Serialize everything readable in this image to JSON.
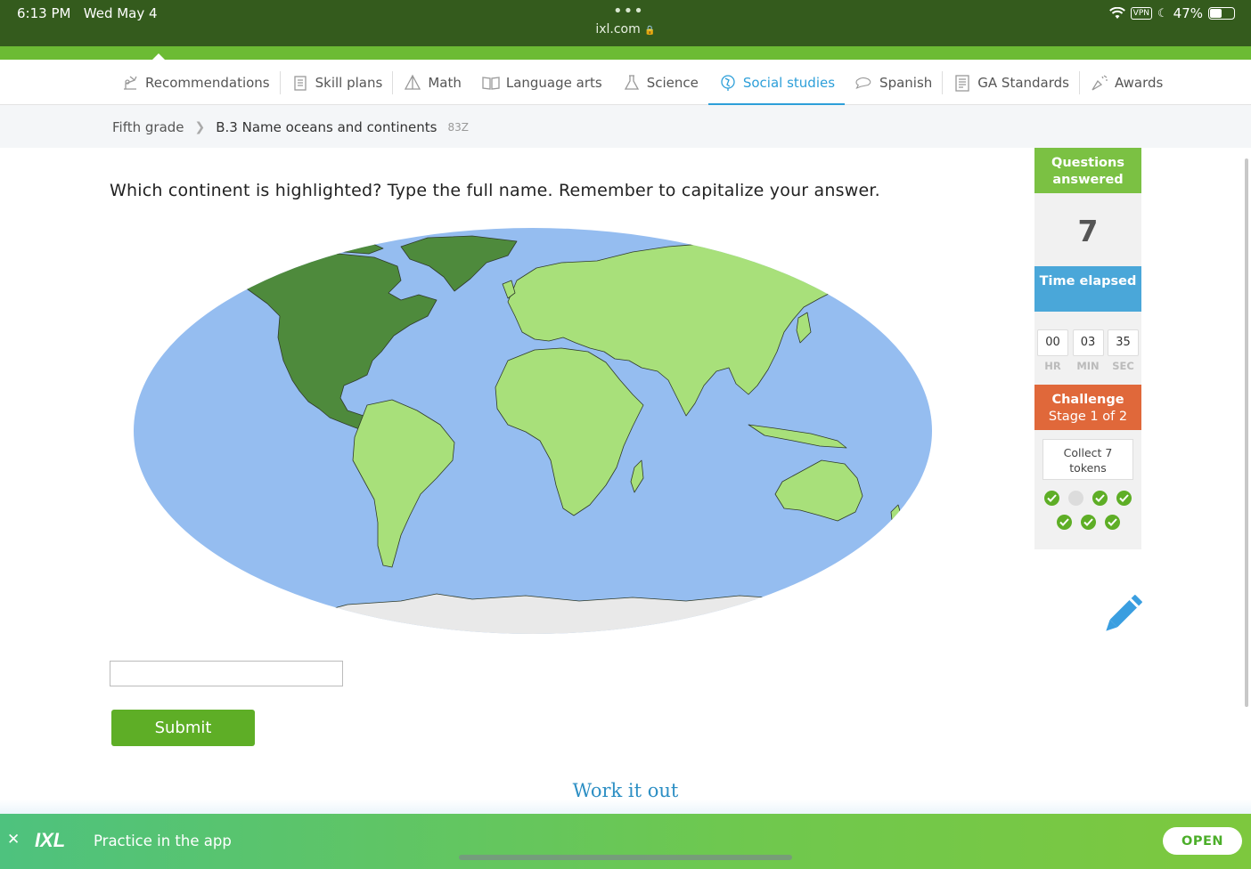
{
  "status_bar": {
    "time": "6:13 PM",
    "date": "Wed May 4",
    "url": "ixl.com",
    "battery": "47%",
    "vpn": "VPN"
  },
  "nav": {
    "items": [
      {
        "label": "Recommendations",
        "icon": "recommendations-icon"
      },
      {
        "label": "Skill plans",
        "icon": "skill-plans-icon"
      },
      {
        "label": "Math",
        "icon": "math-icon"
      },
      {
        "label": "Language arts",
        "icon": "language-arts-icon"
      },
      {
        "label": "Science",
        "icon": "science-icon"
      },
      {
        "label": "Social studies",
        "icon": "social-studies-icon",
        "active": true
      },
      {
        "label": "Spanish",
        "icon": "spanish-icon"
      },
      {
        "label": "GA Standards",
        "icon": "standards-icon"
      },
      {
        "label": "Awards",
        "icon": "awards-icon"
      }
    ]
  },
  "breadcrumb": {
    "grade": "Fifth grade",
    "skill": "B.3 Name oceans and continents",
    "code": "83Z"
  },
  "question": {
    "prompt": "Which continent is highlighted? Type the full name. Remember to capitalize your answer.",
    "answer_value": "",
    "submit_label": "Submit",
    "work_it_out": "Work it out"
  },
  "map_colors": {
    "ocean": "#95bdf0",
    "land": "#a8e07a",
    "highlight": "#4e8a3c",
    "antarctica": "#e9e9e9"
  },
  "sidebar": {
    "questions_answered_label": "Questions answered",
    "questions_answered": "7",
    "time_elapsed_label": "Time elapsed",
    "timer": {
      "hr": "00",
      "min": "03",
      "sec": "35"
    },
    "timer_labels": {
      "hr": "HR",
      "min": "MIN",
      "sec": "SEC"
    },
    "challenge_label": "Challenge",
    "challenge_stage": "Stage 1 of 2",
    "collect_text": "Collect 7 tokens",
    "tokens": [
      true,
      false,
      true,
      true,
      true,
      true,
      true
    ]
  },
  "app_banner": {
    "message": "Practice in the app",
    "open_label": "OPEN",
    "logo": "IXL"
  },
  "colors": {
    "brand_green": "#5eae26",
    "active_blue": "#2d9fd9",
    "challenge_orange": "#e0683a"
  }
}
